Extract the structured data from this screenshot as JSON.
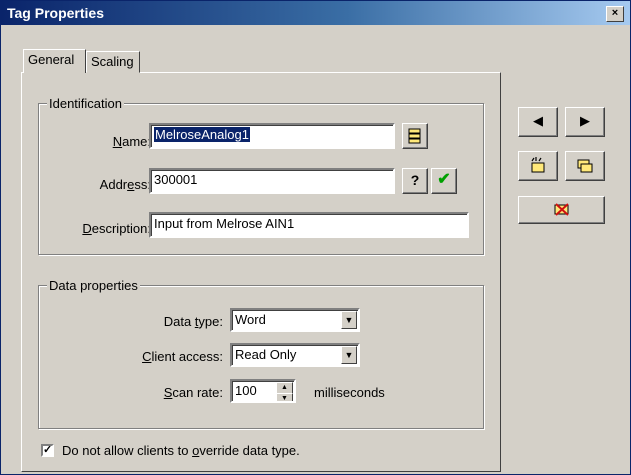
{
  "window": {
    "title": "Tag Properties",
    "close_glyph": "×"
  },
  "tabs": [
    {
      "label": "General",
      "active": true
    },
    {
      "label": "Scaling",
      "active": false
    }
  ],
  "identification": {
    "legend": "Identification",
    "name_label": {
      "mnemonic": "N",
      "rest": "ame:"
    },
    "name_value": "MelroseAnalog1",
    "address_label": {
      "pre": "Addr",
      "mnemonic": "e",
      "rest": "ss:"
    },
    "address_value": "300001",
    "description_label": {
      "mnemonic": "D",
      "rest": "escription:"
    },
    "description_value": "Input from Melrose AIN1",
    "help_glyph": "?",
    "check_glyph": "✔"
  },
  "data_properties": {
    "legend": "Data properties",
    "data_type_label": {
      "pre": "Data ",
      "mnemonic": "t",
      "rest": "ype:"
    },
    "data_type_value": "Word",
    "client_access_label": {
      "mnemonic": "C",
      "rest": "lient access:"
    },
    "client_access_value": "Read Only",
    "scan_rate_label": {
      "mnemonic": "S",
      "rest": "can rate:"
    },
    "scan_rate_value": "100",
    "scan_rate_unit": "milliseconds"
  },
  "override_checkbox": {
    "label_pre": "Do not allow clients to ",
    "label_mnemonic": "o",
    "label_rest": "verride data type.",
    "checked": true,
    "check_glyph": "✓"
  },
  "nav": {
    "prev_glyph": "◀",
    "next_glyph": "▶"
  },
  "colors": {
    "title_bar": "#0a246a",
    "dialog_face": "#d4d0c8",
    "selection": "#0a246a",
    "check_green": "#00a000",
    "tag_yellow": "#ffe97a",
    "delete_red": "#d01010"
  }
}
